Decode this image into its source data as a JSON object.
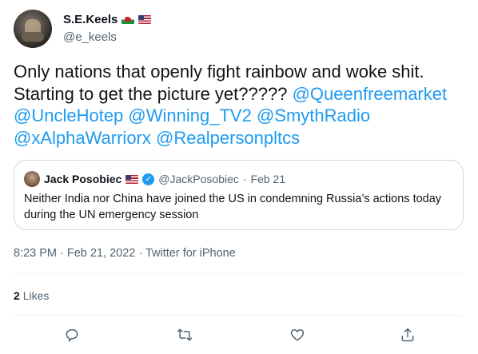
{
  "author": {
    "display_name": "S.E.Keels",
    "handle": "@e_keels",
    "flags": [
      "wales-flag",
      "us-flag"
    ]
  },
  "tweet": {
    "text_plain": "Only nations that openly fight rainbow and woke shit. Starting to get the picture yet?????",
    "mentions": [
      "@Queenfreemarket",
      "@UncleHotep",
      "@Winning_TV2",
      "@SmythRadio",
      "@xAlphaWarriorx",
      "@Realpersonpltcs"
    ]
  },
  "quote": {
    "display_name": "Jack Posobiec",
    "handle": "@JackPosobiec",
    "dot": "·",
    "date": "Feb 21",
    "text": "Neither India nor China have joined the US in condemning Russia’s actions today during the UN emergency session"
  },
  "meta": {
    "time": "8:23 PM · Feb 21, 2022 · Twitter for iPhone"
  },
  "stats": {
    "likes_count": "2",
    "likes_label": "Likes"
  },
  "actions": {
    "icons": [
      "reply-icon",
      "retweet-icon",
      "like-icon",
      "share-icon"
    ]
  },
  "colors": {
    "accent": "#1d9bf0",
    "text": "#0f1419",
    "secondary": "#536471",
    "border": "#cfd9de"
  }
}
